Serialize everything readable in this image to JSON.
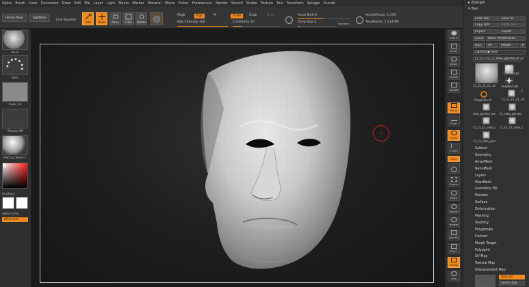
{
  "menubar": {
    "items": [
      "Alpha",
      "Brush",
      "Color",
      "Document",
      "Draw",
      "Edit",
      "File",
      "Layer",
      "Light",
      "Macro",
      "Marker",
      "Material",
      "Movie",
      "Picker",
      "Preferences",
      "Render",
      "Stencil",
      "Stroke",
      "Texture",
      "Tool",
      "Transform",
      "Zplugin",
      "Zscript"
    ]
  },
  "shelf": {
    "home_page": "Home Page",
    "lightbox": "LightBox",
    "live_boolean": "Live Boolean",
    "edit": "Edit",
    "draw": "Draw",
    "move": "Move",
    "scale": "Scale",
    "rotate": "Rotate",
    "mrgb": "Mrgb",
    "rgb": "Rgb",
    "m": "M",
    "rgb_intensity": "Rgb Intensity 100",
    "zadd": "Zadd",
    "zsub": "Zsub",
    "zcut": "Zcut",
    "z_intensity": "Z Intensity 20",
    "focal_shift": "Focal Shift 0",
    "draw_size": "Draw Size 4",
    "dynamic": "Dynamic",
    "active_points": "ActivePoints: 5,376",
    "total_points": "TotalPoints: 5.514 Mil"
  },
  "lefttray": {
    "brush": "Pinch",
    "stroke": "Dots",
    "alpha": "mask_iks",
    "texture": "Texture Off",
    "material": "MatCap White C",
    "gradient": "Gradient",
    "switch_color": "SwitchColor",
    "alternate": "Alternate"
  },
  "righttray": {
    "spix": "SPix 3",
    "scroll": "Scroll",
    "zoom": "Zoom",
    "actual": "Actual",
    "aahalf": "AAHalf",
    "persp": "Persp",
    "floor": "Floor",
    "local": "Local",
    "lsym": "L.Sym",
    "xyz": "Qxyz",
    "frame": "Frame",
    "move": "Move",
    "scale": "ZoomD",
    "rotate": "Rotate",
    "linefill": "Line Fill",
    "polyf": "PolyF",
    "transp": "Transp",
    "dynamic": "Dynamic",
    "solo": "Solo"
  },
  "rpanel": {
    "zplugin": "Zplugin",
    "tool": "Tool",
    "load_tool": "Load Tool",
    "save_as": "Save As",
    "copy_tool": "Copy Tool",
    "paste_tool": "Paste Tool",
    "import": "Import",
    "export": "Export",
    "clone": "Clone",
    "make_polymesh": "Make PolyMesh3D",
    "goz": "GoZ",
    "all": "All",
    "visible": "Visible",
    "r": "R",
    "lightbox_tools": "Lightbox▶Tools",
    "current_tool": "CL_CL_CL_CL_robo_gersha_m",
    "current_count": "8",
    "tools": [
      "CL_CL_CL_CL_rol",
      "Cylinder3D",
      "PolyMesh3D",
      "SimpleBrush",
      "CL_CL_CL_CL_rot",
      "robo_gersha_ma",
      "CL_robo_gersha",
      "CL_CL_CL_robo_c",
      "CL_CL_CL_robo_c",
      "CL_CL_robo_gers"
    ],
    "badge_two": "2",
    "menus": [
      "Subtool",
      "Geometry",
      "ArrayMesh",
      "NanoMesh",
      "Layers",
      "FiberMesh",
      "Geometry HD",
      "Preview",
      "Surface",
      "Deformation",
      "Masking",
      "Visibility",
      "Polygroups",
      "Contact",
      "Morph Target",
      "Polypaint",
      "UV Map",
      "Texture Map",
      "Displacement Map"
    ],
    "disp_on": "Disp On",
    "clone_disp": "Clone Disp"
  },
  "colors": {
    "accent": "#f08a1c",
    "background": "#1b1b1b",
    "panel": "#313131"
  }
}
